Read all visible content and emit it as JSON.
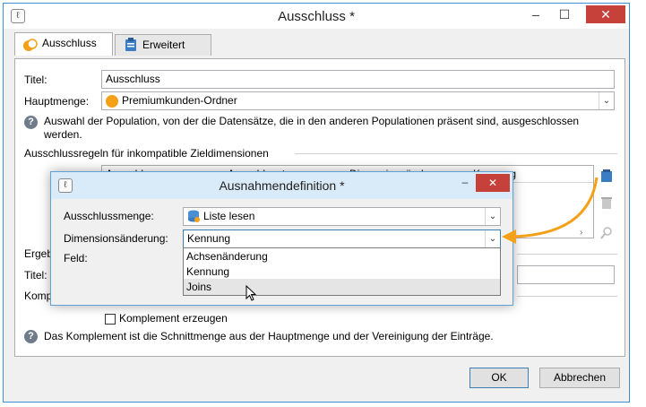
{
  "window": {
    "title": "Ausschluss *",
    "app_icon": "app-logo-icon",
    "minimize": "–",
    "maximize": "☐",
    "close": "✕"
  },
  "tabs": [
    {
      "label": "Ausschluss",
      "icon": "exclusion-icon",
      "active": true
    },
    {
      "label": "Erweitert",
      "icon": "clipboard-icon",
      "active": false
    }
  ],
  "form": {
    "titel_label": "Titel:",
    "titel_value": "Ausschluss",
    "hauptmenge_label": "Hauptmenge:",
    "hauptmenge_value": "Premiumkunden-Ordner",
    "help_text_1": "Auswahl der Population, von der die Datensätze, die in den anderen Populationen präsent sind, ausgeschlossen werden.",
    "rules_section_label": "Ausschlussregeln für inkompatible Zieldimensionen",
    "rules_columns": [
      "Ausschlussmenge",
      "Ausschlussty",
      "Dimensionsänderung",
      "Kennung"
    ],
    "ergebnis_label": "Ergeb",
    "titel2_label": "Titel:",
    "komplement_label": "Komp",
    "komplement_checkbox_label": "Komplement erzeugen",
    "help_text_2": "Das Komplement ist die Schnittmenge aus der Hauptmenge und der Vereinigung der Einträge."
  },
  "buttons": {
    "ok": "OK",
    "cancel": "Abbrechen"
  },
  "dialog": {
    "title": "Ausnahmendefinition *",
    "ausschlussmenge_label": "Ausschlussmenge:",
    "ausschlussmenge_value": "Liste lesen",
    "dimension_label": "Dimensionsänderung:",
    "dimension_value": "Kennung",
    "feld_label": "Feld:",
    "dropdown_options": [
      "Achsenänderung",
      "Kennung",
      "Joins"
    ],
    "highlighted_option": "Joins"
  },
  "colors": {
    "accent": "#3b8fd2",
    "orange": "#f4a018",
    "close": "#c7413b"
  }
}
